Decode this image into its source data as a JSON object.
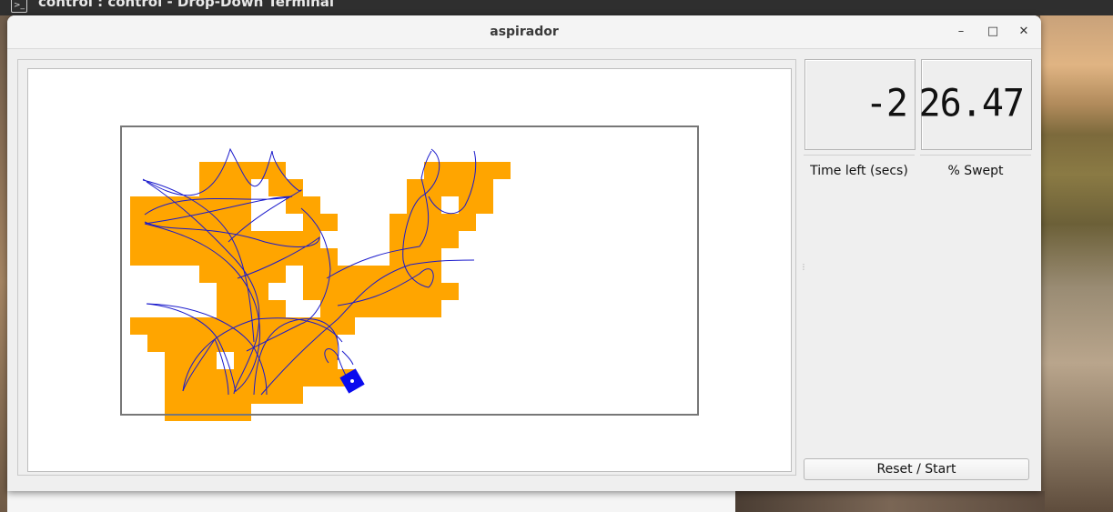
{
  "terminal": {
    "title": "control : control - Drop-Down Terminal",
    "icon": "terminal-icon"
  },
  "window": {
    "title": "aspirador",
    "controls": [
      "minimize",
      "maximize",
      "close"
    ],
    "minimize_glyph": "–",
    "maximize_glyph": "□",
    "close_glyph": "✕"
  },
  "displays": {
    "time_left": {
      "value": "-2",
      "label": "Time left (secs)"
    },
    "swept": {
      "value": "26.47",
      "label": "% Swept"
    }
  },
  "button": {
    "label": "Reset / Start"
  },
  "simulation": {
    "room_color": "#ffffff",
    "swept_color": "#ffa500",
    "path_color": "#1a1acc",
    "robot_color": "#0a0aee",
    "cols": 33,
    "rows": 16,
    "swept_cells": [
      [
        4,
        1
      ],
      [
        5,
        1
      ],
      [
        6,
        1
      ],
      [
        7,
        1
      ],
      [
        8,
        1
      ],
      [
        4,
        2
      ],
      [
        5,
        2
      ],
      [
        6,
        2
      ],
      [
        8,
        2
      ],
      [
        9,
        2
      ],
      [
        0,
        3
      ],
      [
        1,
        3
      ],
      [
        2,
        3
      ],
      [
        3,
        3
      ],
      [
        4,
        3
      ],
      [
        5,
        3
      ],
      [
        6,
        3
      ],
      [
        9,
        3
      ],
      [
        10,
        3
      ],
      [
        0,
        4
      ],
      [
        1,
        4
      ],
      [
        2,
        4
      ],
      [
        3,
        4
      ],
      [
        4,
        4
      ],
      [
        5,
        4
      ],
      [
        6,
        4
      ],
      [
        10,
        4
      ],
      [
        11,
        4
      ],
      [
        0,
        5
      ],
      [
        1,
        5
      ],
      [
        2,
        5
      ],
      [
        3,
        5
      ],
      [
        4,
        5
      ],
      [
        5,
        5
      ],
      [
        6,
        5
      ],
      [
        7,
        5
      ],
      [
        8,
        5
      ],
      [
        9,
        5
      ],
      [
        10,
        5
      ],
      [
        0,
        6
      ],
      [
        1,
        6
      ],
      [
        2,
        6
      ],
      [
        3,
        6
      ],
      [
        4,
        6
      ],
      [
        5,
        6
      ],
      [
        6,
        6
      ],
      [
        7,
        6
      ],
      [
        8,
        6
      ],
      [
        9,
        6
      ],
      [
        10,
        6
      ],
      [
        11,
        6
      ],
      [
        4,
        7
      ],
      [
        5,
        7
      ],
      [
        6,
        7
      ],
      [
        7,
        7
      ],
      [
        8,
        7
      ],
      [
        10,
        7
      ],
      [
        11,
        7
      ],
      [
        12,
        7
      ],
      [
        13,
        7
      ],
      [
        14,
        7
      ],
      [
        15,
        7
      ],
      [
        5,
        8
      ],
      [
        6,
        8
      ],
      [
        7,
        8
      ],
      [
        10,
        8
      ],
      [
        11,
        8
      ],
      [
        12,
        8
      ],
      [
        13,
        8
      ],
      [
        14,
        8
      ],
      [
        15,
        8
      ],
      [
        5,
        9
      ],
      [
        6,
        9
      ],
      [
        7,
        9
      ],
      [
        8,
        9
      ],
      [
        11,
        9
      ],
      [
        12,
        9
      ],
      [
        13,
        9
      ],
      [
        0,
        10
      ],
      [
        1,
        10
      ],
      [
        2,
        10
      ],
      [
        3,
        10
      ],
      [
        4,
        10
      ],
      [
        5,
        10
      ],
      [
        6,
        10
      ],
      [
        7,
        10
      ],
      [
        8,
        10
      ],
      [
        9,
        10
      ],
      [
        10,
        10
      ],
      [
        11,
        10
      ],
      [
        12,
        10
      ],
      [
        1,
        11
      ],
      [
        2,
        11
      ],
      [
        3,
        11
      ],
      [
        4,
        11
      ],
      [
        5,
        11
      ],
      [
        6,
        11
      ],
      [
        7,
        11
      ],
      [
        8,
        11
      ],
      [
        9,
        11
      ],
      [
        10,
        11
      ],
      [
        11,
        11
      ],
      [
        2,
        12
      ],
      [
        3,
        12
      ],
      [
        4,
        12
      ],
      [
        6,
        12
      ],
      [
        7,
        12
      ],
      [
        8,
        12
      ],
      [
        9,
        12
      ],
      [
        10,
        12
      ],
      [
        11,
        12
      ],
      [
        2,
        13
      ],
      [
        3,
        13
      ],
      [
        4,
        13
      ],
      [
        5,
        13
      ],
      [
        6,
        13
      ],
      [
        7,
        13
      ],
      [
        8,
        13
      ],
      [
        9,
        13
      ],
      [
        10,
        13
      ],
      [
        11,
        13
      ],
      [
        12,
        13
      ],
      [
        2,
        14
      ],
      [
        3,
        14
      ],
      [
        4,
        14
      ],
      [
        5,
        14
      ],
      [
        6,
        14
      ],
      [
        7,
        14
      ],
      [
        8,
        14
      ],
      [
        9,
        14
      ],
      [
        2,
        15
      ],
      [
        3,
        15
      ],
      [
        4,
        15
      ],
      [
        5,
        15
      ],
      [
        6,
        15
      ],
      [
        17,
        1
      ],
      [
        18,
        1
      ],
      [
        19,
        1
      ],
      [
        20,
        1
      ],
      [
        21,
        1
      ],
      [
        16,
        2
      ],
      [
        17,
        2
      ],
      [
        18,
        2
      ],
      [
        19,
        2
      ],
      [
        20,
        2
      ],
      [
        16,
        3
      ],
      [
        17,
        3
      ],
      [
        19,
        3
      ],
      [
        20,
        3
      ],
      [
        15,
        4
      ],
      [
        16,
        4
      ],
      [
        17,
        4
      ],
      [
        18,
        4
      ],
      [
        19,
        4
      ],
      [
        15,
        5
      ],
      [
        16,
        5
      ],
      [
        17,
        5
      ],
      [
        18,
        5
      ],
      [
        15,
        6
      ],
      [
        16,
        6
      ],
      [
        17,
        6
      ],
      [
        15,
        7
      ],
      [
        16,
        7
      ],
      [
        17,
        7
      ],
      [
        15,
        8
      ],
      [
        16,
        8
      ],
      [
        17,
        8
      ],
      [
        18,
        8
      ],
      [
        13,
        9
      ],
      [
        14,
        9
      ],
      [
        15,
        9
      ],
      [
        16,
        9
      ],
      [
        17,
        9
      ],
      [
        16,
        8
      ]
    ]
  }
}
